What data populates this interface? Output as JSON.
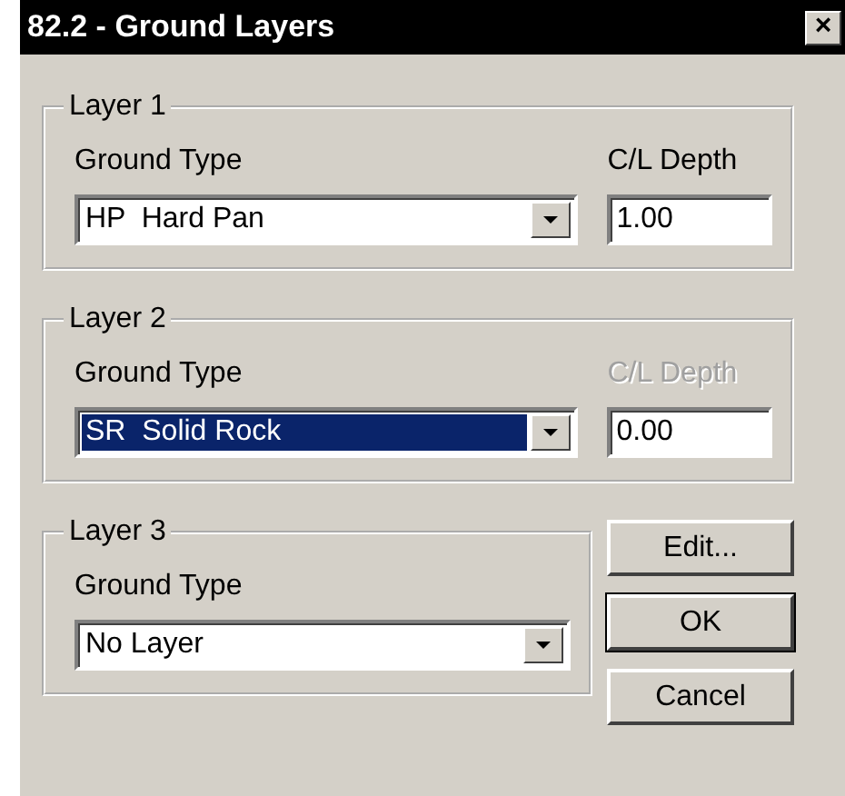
{
  "window": {
    "title": "82.2 - Ground Layers",
    "close": "×"
  },
  "layers": [
    {
      "title": "Layer 1",
      "ground_type_label": "Ground Type",
      "ground_type": "HP  Hard Pan",
      "focused": false,
      "depth_label": "C/L Depth",
      "depth_disabled": false,
      "depth": "1.00"
    },
    {
      "title": "Layer 2",
      "ground_type_label": "Ground Type",
      "ground_type": "SR  Solid Rock",
      "focused": true,
      "depth_label": "C/L Depth",
      "depth_disabled": true,
      "depth": "0.00"
    },
    {
      "title": "Layer 3",
      "ground_type_label": "Ground Type",
      "ground_type": "No Layer",
      "focused": false
    }
  ],
  "buttons": [
    {
      "label": "Edit...",
      "default": false
    },
    {
      "label": "OK",
      "default": true
    },
    {
      "label": "Cancel",
      "default": false
    }
  ]
}
